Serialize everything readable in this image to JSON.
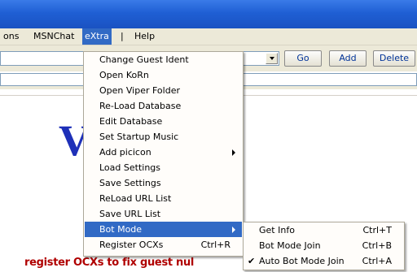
{
  "menubar": {
    "items": [
      {
        "label": "ons"
      },
      {
        "label": "MSNChat"
      },
      {
        "label": "eXtra"
      },
      {
        "label": "|"
      },
      {
        "label": "Help"
      }
    ]
  },
  "toolbar": {
    "go_label": "Go",
    "add_label": "Add",
    "delete_label": "Delete"
  },
  "content": {
    "big_letter": "V",
    "footer_text": "register OCXs to fix guest  nul"
  },
  "extra_menu": {
    "items": [
      {
        "label": "Change Guest Ident"
      },
      {
        "label": "Open KoRn"
      },
      {
        "label": "Open Viper Folder"
      },
      {
        "label": "Re-Load Database"
      },
      {
        "label": "Edit Database"
      },
      {
        "label": "Set Startup Music"
      },
      {
        "label": "Add picicon"
      },
      {
        "label": "Load Settings"
      },
      {
        "label": "Save Settings"
      },
      {
        "label": "ReLoad URL List"
      },
      {
        "label": "Save URL List"
      },
      {
        "label": "Bot Mode"
      },
      {
        "label": "Register OCXs",
        "shortcut": "Ctrl+R"
      }
    ]
  },
  "bot_mode_submenu": {
    "items": [
      {
        "label": "Get Info",
        "shortcut": "Ctrl+T"
      },
      {
        "label": "Bot Mode Join",
        "shortcut": "Ctrl+B"
      },
      {
        "label": "Auto Bot Mode Join",
        "shortcut": "Ctrl+A",
        "checked": true
      }
    ]
  },
  "colors": {
    "menu_highlight": "#316ac5",
    "title_blue": "#1f5fd4",
    "footer_red": "#b00000",
    "big_letter_blue": "#1e30b8"
  },
  "icons": [
    "dropdown-arrow-icon",
    "submenu-arrow-icon",
    "checkmark-icon"
  ]
}
